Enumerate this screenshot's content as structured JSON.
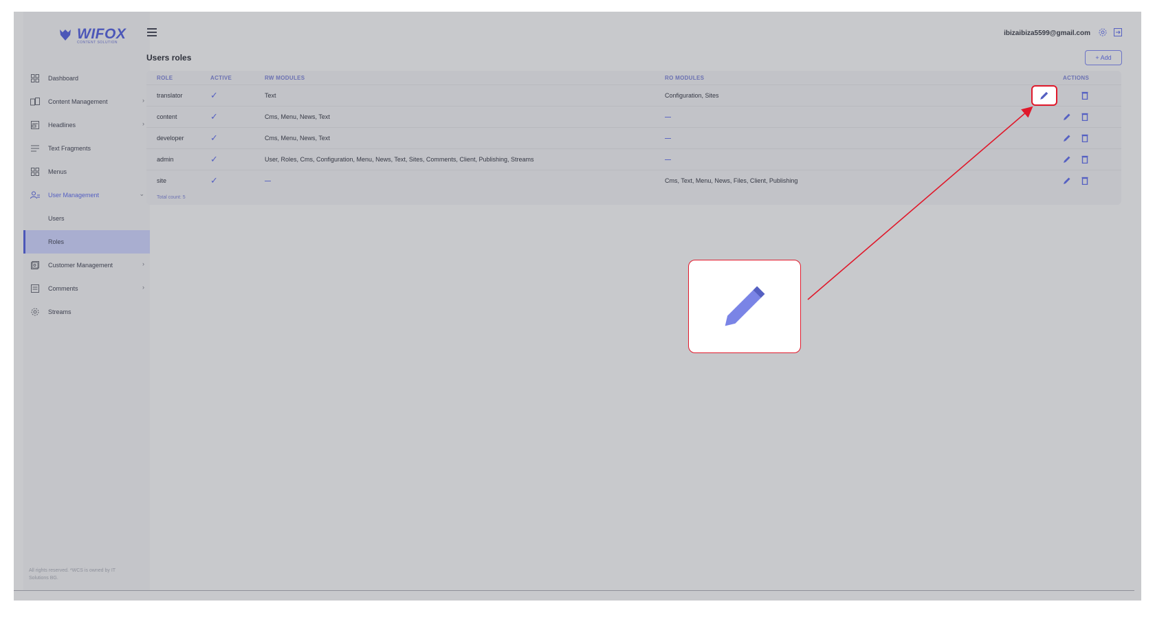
{
  "brand": {
    "name": "WIFOX",
    "tagline": "CONTENT SOLUTION"
  },
  "header": {
    "user_email": "ibizaibiza5599@gmail.com"
  },
  "sidebar": {
    "items": [
      {
        "label": "Dashboard",
        "icon": "dashboard-icon"
      },
      {
        "label": "Content Management",
        "icon": "content-management-icon",
        "chevron": true
      },
      {
        "label": "Headlines",
        "icon": "headlines-icon",
        "chevron": true
      },
      {
        "label": "Text Fragments",
        "icon": "text-fragments-icon"
      },
      {
        "label": "Menus",
        "icon": "menus-icon"
      },
      {
        "label": "User Management",
        "icon": "user-management-icon",
        "chevron": true,
        "expanded": true,
        "children": [
          {
            "label": "Users"
          },
          {
            "label": "Roles",
            "active": true
          }
        ]
      },
      {
        "label": "Customer Management",
        "icon": "customer-management-icon",
        "chevron": true
      },
      {
        "label": "Comments",
        "icon": "comments-icon",
        "chevron": true
      },
      {
        "label": "Streams",
        "icon": "streams-icon"
      }
    ],
    "footer": "All rights reserved. *WCS is owned by IT Solutions BG."
  },
  "main": {
    "title": "Users roles",
    "add_label": "+ Add",
    "columns": [
      "ROLE",
      "ACTIVE",
      "RW MODULES",
      "RO MODULES",
      "ACTIONS"
    ],
    "rows": [
      {
        "role": "translator",
        "active": "✓",
        "rw": "Text",
        "ro": "Configuration, Sites"
      },
      {
        "role": "content",
        "active": "✓",
        "rw": "Cms, Menu, News, Text",
        "ro": "—"
      },
      {
        "role": "developer",
        "active": "✓",
        "rw": "Cms, Menu, News, Text",
        "ro": "—"
      },
      {
        "role": "admin",
        "active": "✓",
        "rw": "User, Roles, Cms, Configuration, Menu, News, Text, Sites, Comments, Client, Publishing, Streams",
        "ro": "—"
      },
      {
        "role": "site",
        "active": "✓",
        "rw": "—",
        "ro": "Cms, Text, Menu, News, Files, Client, Publishing"
      }
    ],
    "total_count": "Total count: 5"
  },
  "colors": {
    "accent": "#4c57b8",
    "annotation": "#e0182a",
    "overlay_bg": "#c8c9cc"
  }
}
